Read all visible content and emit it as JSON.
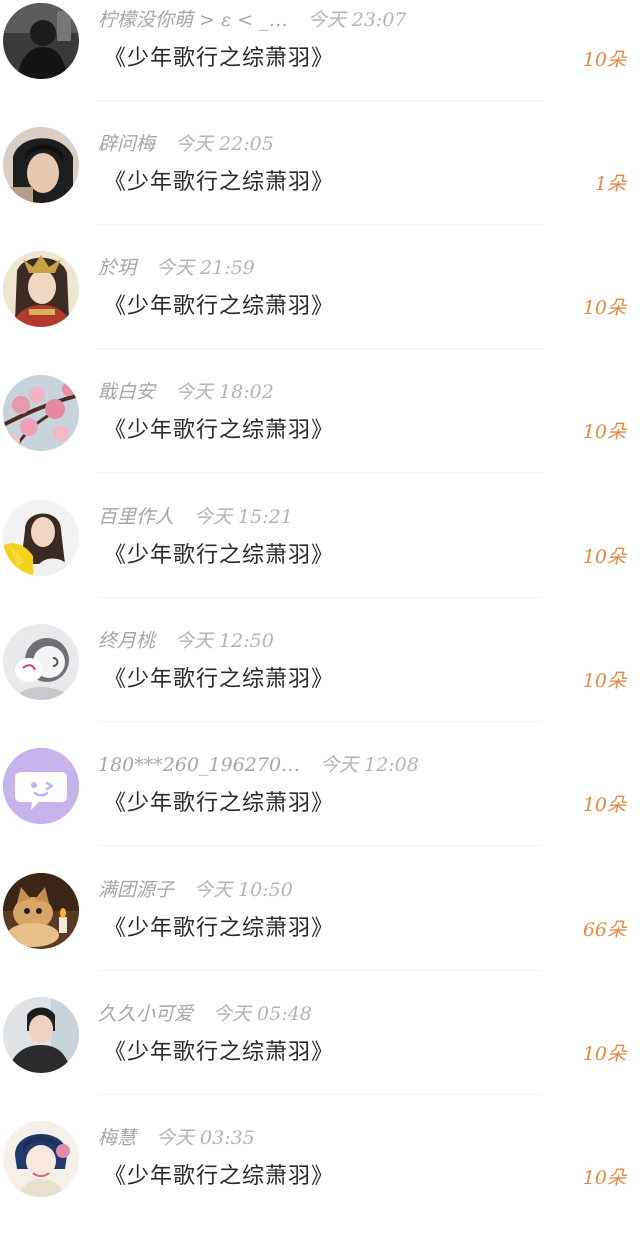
{
  "colors": {
    "username_text": "#a6a6a6",
    "count_text": "#e08a4a",
    "message_text": "#2a2a2a",
    "divider": "#f1f1f1"
  },
  "gifts": [
    {
      "user": "柠檬没你萌 > ε < _…",
      "time": "今天 23:07",
      "message": "《少年歌行之综萧羽》",
      "count": "10朵",
      "avatar_icon": "photo-avatar-dark"
    },
    {
      "user": "辟问梅",
      "time": "今天 22:05",
      "message": "《少年歌行之综萧羽》",
      "count": "1朵",
      "avatar_icon": "photo-avatar-portrait"
    },
    {
      "user": "於玥",
      "time": "今天 21:59",
      "message": "《少年歌行之综萧羽》",
      "count": "10朵",
      "avatar_icon": "photo-avatar-illustration"
    },
    {
      "user": "戢白安",
      "time": "今天 18:02",
      "message": "《少年歌行之综萧羽》",
      "count": "10朵",
      "avatar_icon": "photo-avatar-blossom"
    },
    {
      "user": "百里作人",
      "time": "今天 15:21",
      "message": "《少年歌行之综萧羽》",
      "count": "10朵",
      "avatar_icon": "photo-avatar-girl-yellow"
    },
    {
      "user": "终月桃",
      "time": "今天 12:50",
      "message": "《少年歌行之综萧羽》",
      "count": "10朵",
      "avatar_icon": "photo-avatar-cartoon"
    },
    {
      "user": "180***260_196270…",
      "time": "今天 12:08",
      "message": "《少年歌行之综萧羽》",
      "count": "10朵",
      "avatar_icon": "default-chat-avatar-icon"
    },
    {
      "user": "满团源子",
      "time": "今天 10:50",
      "message": "《少年歌行之综萧羽》",
      "count": "66朵",
      "avatar_icon": "photo-avatar-cat"
    },
    {
      "user": "久久小可爱",
      "time": "今天 05:48",
      "message": "《少年歌行之综萧羽》",
      "count": "10朵",
      "avatar_icon": "photo-avatar-boy"
    },
    {
      "user": "梅慧",
      "time": "今天 03:35",
      "message": "《少年歌行之综萧羽》",
      "count": "10朵",
      "avatar_icon": "photo-avatar-ink-girl"
    }
  ]
}
